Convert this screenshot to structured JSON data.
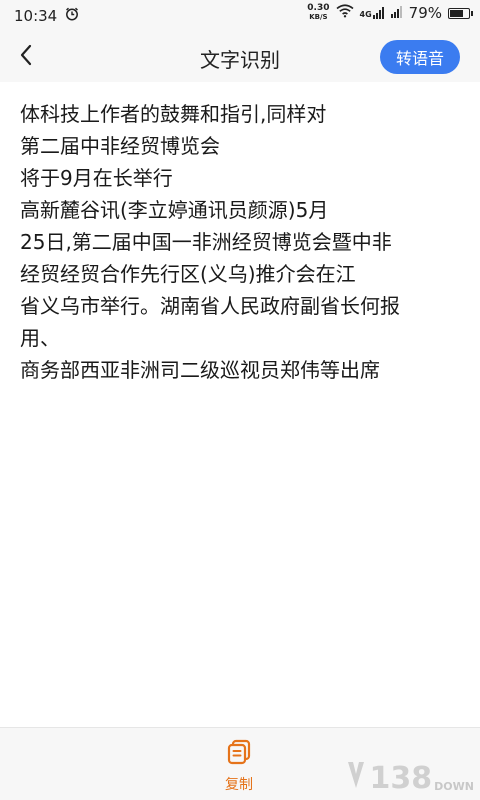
{
  "status_bar": {
    "time": "10:34",
    "net_speed_value": "0.30",
    "net_speed_unit": "KB/S",
    "network_type": "4G",
    "battery_percent": "79%",
    "battery_level": 0.79
  },
  "header": {
    "title": "文字识别",
    "tts_button_label": "转语音"
  },
  "content": {
    "lines": [
      "体科技上作者的鼓舞和指引,同样对",
      "第二届中非经贸博览会",
      "将于9月在长举行",
      "高新麓谷讯(李立婷通讯员颜源)5月",
      "25日,第二届中国一非洲经贸博览会暨中非",
      "经贸经贸合作先行区(义乌)推介会在江",
      "省义乌市举行。湖南省人民政府副省长何报",
      "用、",
      "商务部西亚非洲司二级巡视员郑伟等出席"
    ]
  },
  "bottom_bar": {
    "copy_label": "复制"
  },
  "watermark": {
    "text_big": "138",
    "text_small": "DOWN"
  },
  "colors": {
    "accent_blue": "#3b7cf0",
    "accent_orange": "#e5731a",
    "bar_background": "#f7f7f7"
  }
}
